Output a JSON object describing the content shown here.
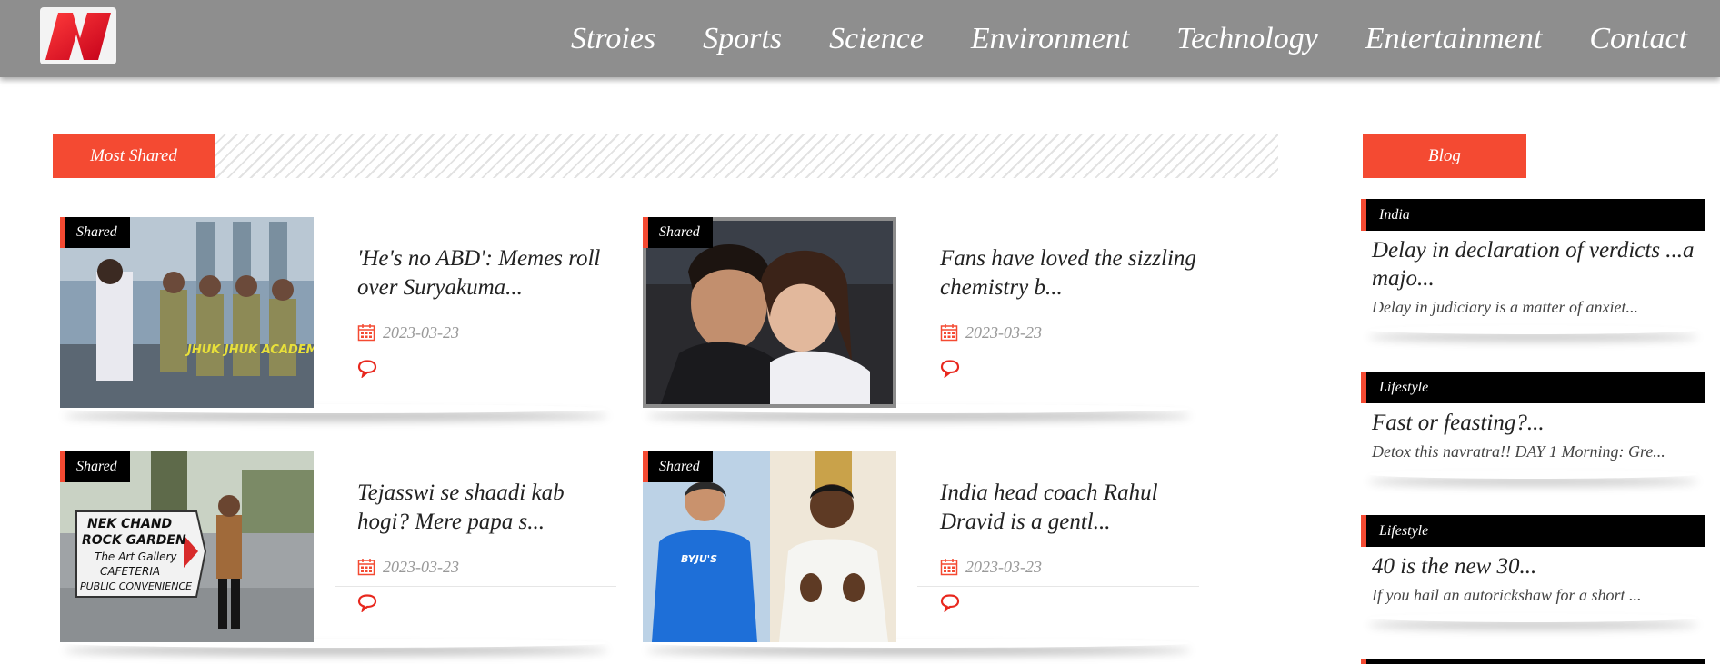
{
  "brand": {
    "logo_letter": "N",
    "accent": "#f44a32"
  },
  "nav": [
    "Stroies",
    "Sports",
    "Science",
    "Environment",
    "Technology",
    "Entertainment",
    "Contact"
  ],
  "most_shared": {
    "label": "Most Shared",
    "cards": [
      {
        "badge": "Shared",
        "title": "'He's no ABD': Memes roll over Suryakuma...",
        "date": "2023-03-23"
      },
      {
        "badge": "Shared",
        "title": "Fans have loved the sizzling chemistry b...",
        "date": "2023-03-23"
      },
      {
        "badge": "Shared",
        "title": "Tejasswi se shaadi kab hogi? Mere papa s...",
        "date": "2023-03-23"
      },
      {
        "badge": "Shared",
        "title": "India head coach Rahul Dravid is a gentl...",
        "date": "2023-03-23"
      }
    ],
    "image_text": {
      "card1_overlay": "JHUK JHUK ACADEMY",
      "card3_sign": [
        "NEK CHAND",
        "ROCK GARDEN",
        "The Art Gallery",
        "CAFETERIA",
        "PUBLIC CONVENIENCE"
      ],
      "card4_jersey": "BYJU'S"
    }
  },
  "sidebar": {
    "label": "Blog",
    "items": [
      {
        "category": "India",
        "title": "Delay in declaration of verdicts ...a majo...",
        "desc": "Delay in judiciary is a matter of anxiet..."
      },
      {
        "category": "Lifestyle",
        "title": "Fast or feasting?...",
        "desc": "Detox this navratra!! DAY 1 Morning: Gre..."
      },
      {
        "category": "Lifestyle",
        "title": "40 is the new 30...",
        "desc": "If you hail an autorickshaw for a short ..."
      }
    ]
  },
  "icons": {
    "date": "calendar-icon",
    "comments": "comment-icon"
  }
}
